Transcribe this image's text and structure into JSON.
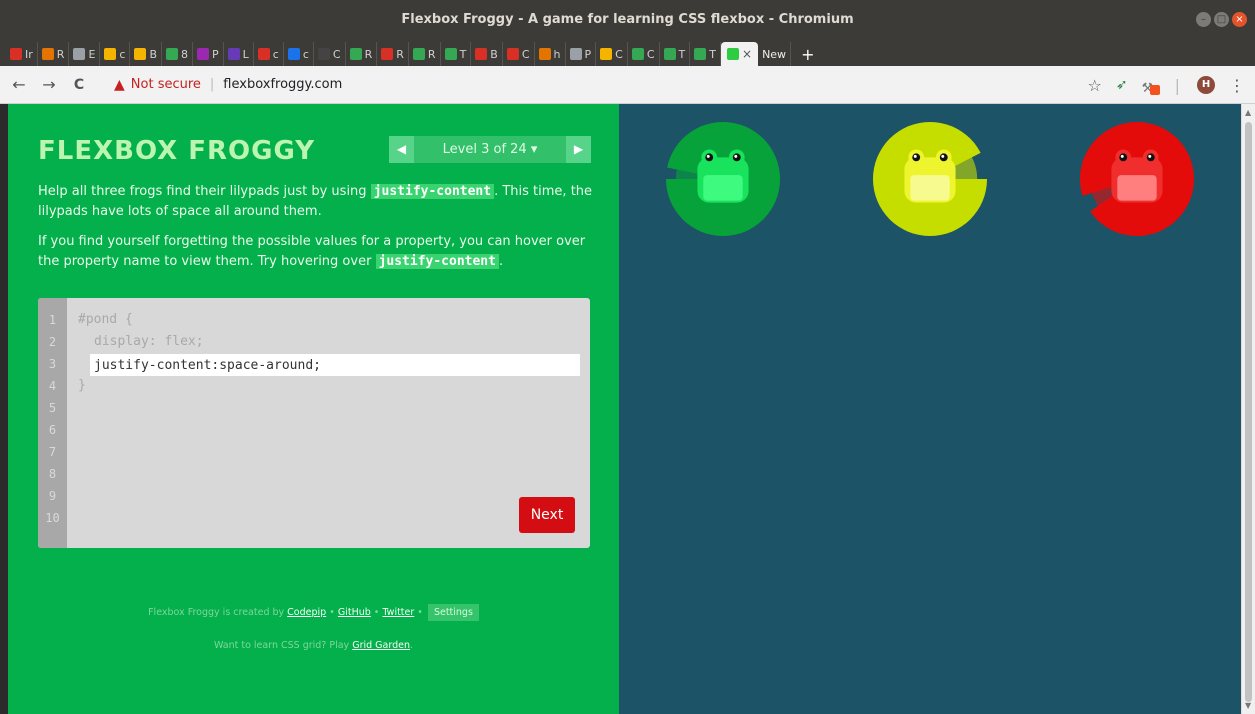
{
  "window": {
    "title": "Flexbox Froggy - A game for learning CSS flexbox - Chromium"
  },
  "tabs": [
    {
      "label": "Ir",
      "color": "#d93025"
    },
    {
      "label": "R",
      "color": "#e37400"
    },
    {
      "label": "E",
      "color": "#9aa0a6"
    },
    {
      "label": "c",
      "color": "#f4b400"
    },
    {
      "label": "B",
      "color": "#f4b400"
    },
    {
      "label": "8",
      "color": "#34a853"
    },
    {
      "label": "P",
      "color": "#9c27b0"
    },
    {
      "label": "L",
      "color": "#673ab7"
    },
    {
      "label": "c",
      "color": "#d93025"
    },
    {
      "label": "c",
      "color": "#1a73e8"
    },
    {
      "label": "C",
      "color": "#444444"
    },
    {
      "label": "R",
      "color": "#34a853"
    },
    {
      "label": "R",
      "color": "#d93025"
    },
    {
      "label": "R",
      "color": "#34a853"
    },
    {
      "label": "T",
      "color": "#34a853"
    },
    {
      "label": "B",
      "color": "#d93025"
    },
    {
      "label": "C",
      "color": "#d93025"
    },
    {
      "label": "h",
      "color": "#e37400"
    },
    {
      "label": "P",
      "color": "#9aa0a6"
    },
    {
      "label": "C",
      "color": "#f4b400"
    },
    {
      "label": "C",
      "color": "#34a853"
    },
    {
      "label": "T",
      "color": "#34a853"
    },
    {
      "label": "T",
      "color": "#34a853"
    }
  ],
  "active_tab": {
    "close": "×"
  },
  "new_tab": {
    "label": "New"
  },
  "navbar": {
    "back": "←",
    "forward": "→",
    "reload": "C",
    "security_label": "Not secure",
    "url": "flexboxfroggy.com",
    "avatar_letter": "H"
  },
  "game": {
    "title": "FLEXBOX FROGGY",
    "level_label": "Level 3 of 24 ▾",
    "prev": "◀",
    "next": "▶",
    "desc1_pre": "Help all three frogs find their lilypads just by using ",
    "desc1_code": "justify-content",
    "desc1_post": ". This time, the lilypads have lots of space all around them.",
    "desc2_pre": "If you find yourself forgetting the possible values for a property, you can hover over the property name to view them. Try hovering over ",
    "desc2_code": "justify-content",
    "desc2_post": "."
  },
  "editor": {
    "line_numbers": [
      "1",
      "2",
      "3",
      "4",
      "5",
      "6",
      "7",
      "8",
      "9",
      "10"
    ],
    "line1": "#pond {",
    "line2": "display: flex;",
    "input_value": "justify-content:space-around;",
    "line4": "}",
    "next_label": "Next"
  },
  "footer": {
    "created_by": "Flexbox Froggy is created by ",
    "codepip": "Codepip",
    "dot": " • ",
    "github": "GitHub",
    "twitter": "Twitter",
    "settings": "Settings",
    "learn_grid": "Want to learn CSS grid? Play ",
    "grid_garden": "Grid Garden",
    "period": "."
  },
  "frogs": [
    {
      "color": "green",
      "lily": "#07a33a",
      "body": "#19e35c",
      "belly": "#3efb80"
    },
    {
      "color": "yellow",
      "lily": "#c6dd00",
      "body": "#eef52e",
      "belly": "#f7fb8f"
    },
    {
      "color": "red",
      "lily": "#e40b0b",
      "body": "#f02e2e",
      "belly": "#ff7f7f"
    }
  ]
}
